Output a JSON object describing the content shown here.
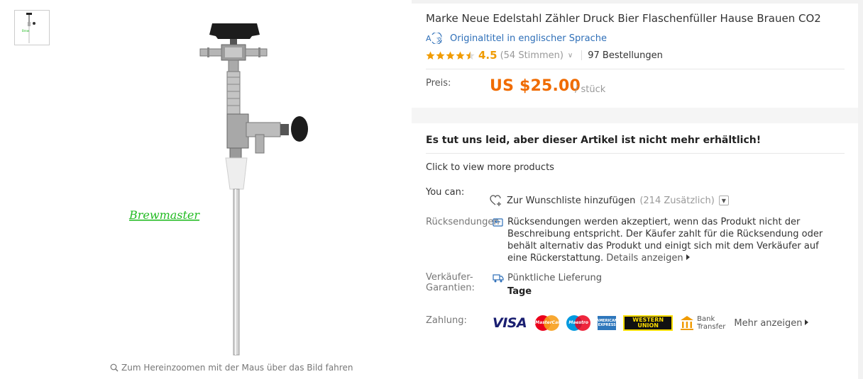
{
  "gallery": {
    "watermark": "Brewmaster",
    "zoom_hint": "Zum Hereinzoomen mit der Maus über das Bild fahren"
  },
  "product": {
    "title": "Marke Neue Edelstahl Zähler Druck Bier Flaschenfüller Hause Brauen CO2",
    "original_title_link": "Originaltitel in englischer Sprache",
    "rating": {
      "stars": 4.5,
      "score": "4.5",
      "votes": "(54 Stimmen)",
      "orders": "97 Bestellungen"
    },
    "price_label": "Preis:",
    "price": "US $25.00",
    "price_unit": "/ stück",
    "unavailable": "Es tut uns leid, aber dieser Artikel ist nicht mehr erhältlich!",
    "click_more": "Click to view more products",
    "you_can_label": "You can:",
    "wishlist": "Zur Wunschliste hinzufügen",
    "wishlist_count": "(214 Zusätzlich)",
    "returns_label": "Rücksendungen",
    "returns_text": "Rücksendungen werden akzeptiert, wenn das Produkt nicht der Beschreibung entspricht. Der Käufer zahlt für die Rücksendung oder behält alternativ das Produkt und einigt sich mit dem Verkäufer auf eine Rückerstattung.",
    "returns_link": "Details anzeigen",
    "guarantee_label_1": "Verkäufer-",
    "guarantee_label_2": "Garantien:",
    "guarantee_1": "Pünktliche Lieferung",
    "guarantee_2": "Tage",
    "payment_label": "Zahlung:",
    "payments": {
      "visa": "VISA",
      "mastercard": "MasterCard",
      "maestro": "Maestro",
      "amex": "AMERICAN EXPRESS",
      "wu_1": "WESTERN",
      "wu_2": "UNION",
      "bank_1": "Bank",
      "bank_2": "Transfer"
    },
    "more_payments": "Mehr anzeigen"
  },
  "colors": {
    "price": "#f06b00",
    "star": "#f09b00",
    "link": "#2e6fb8",
    "watermark": "#22bb22"
  }
}
